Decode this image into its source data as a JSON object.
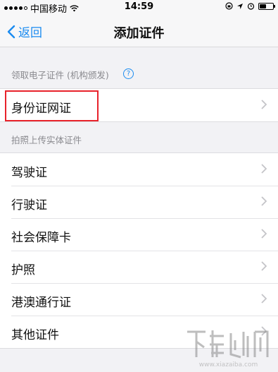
{
  "status_bar": {
    "carrier": "中国移动",
    "time": "14:59"
  },
  "nav": {
    "back_label": "返回",
    "title": "添加证件"
  },
  "section1": {
    "header": "领取电子证件 (机构颁发)",
    "items": [
      {
        "label": "身份证网证"
      }
    ]
  },
  "section2": {
    "header": "拍照上传实体证件",
    "items": [
      {
        "label": "驾驶证"
      },
      {
        "label": "行驶证"
      },
      {
        "label": "社会保障卡"
      },
      {
        "label": "护照"
      },
      {
        "label": "港澳通行证"
      },
      {
        "label": "其他证件"
      }
    ]
  },
  "watermark": {
    "domain": "www.xiazaiba.com"
  },
  "colors": {
    "accent": "#1a8bf0",
    "highlight": "#e8222b",
    "background": "#f2f2f5"
  }
}
